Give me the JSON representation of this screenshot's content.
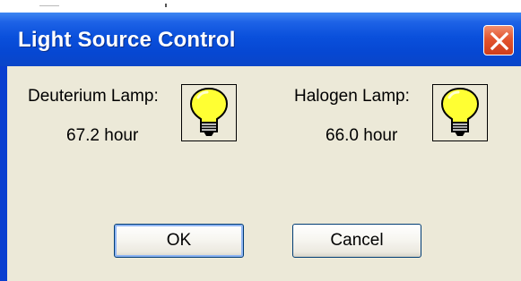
{
  "dialog": {
    "title": "Light Source Control",
    "close_icon": "close-x-icon",
    "deuterium": {
      "label": "Deuterium Lamp:",
      "hours": "67.2 hour",
      "icon": "light-bulb-icon"
    },
    "halogen": {
      "label": "Halogen Lamp:",
      "hours": "66.0 hour",
      "icon": "light-bulb-icon"
    },
    "buttons": {
      "ok": "OK",
      "cancel": "Cancel"
    }
  },
  "colors": {
    "titlebar": "#0a50dc",
    "client_bg": "#ece9d8",
    "close_button": "#e3552f",
    "bulb_yellow": "#ffff33"
  }
}
